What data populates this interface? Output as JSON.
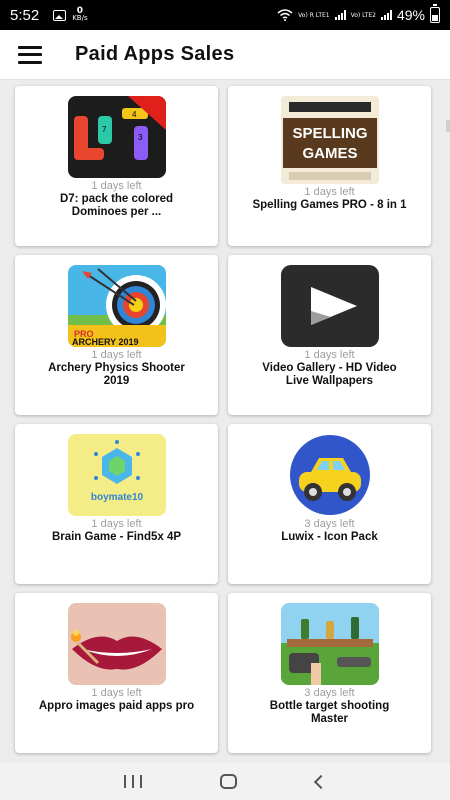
{
  "status": {
    "time": "5:52",
    "net_speed": "0",
    "net_unit": "KB/s",
    "lte1": "Vo) R LTE1",
    "lte2": "Vo) LTE2",
    "battery": "49%"
  },
  "app_bar": {
    "title": "Paid Apps Sales"
  },
  "apps": [
    {
      "days": "1 days left",
      "name": "D7: pack the colored Dominoes per ...",
      "icon": "domino-game-icon"
    },
    {
      "days": "1 days left",
      "name": "Spelling Games PRO - 8 in 1",
      "icon": "spelling-games-icon",
      "icon_text": "SPELLING GAMES"
    },
    {
      "days": "1 days left",
      "name": "Archery Physics Shooter 2019",
      "icon": "archery-target-icon",
      "icon_text": "PRO ARCHERY 2019"
    },
    {
      "days": "1 days left",
      "name": "Video Gallery - HD Video Live Wallpapers",
      "icon": "play-icon"
    },
    {
      "days": "1 days left",
      "name": "Brain Game - Find5x 4P",
      "icon": "hexagon-brain-icon",
      "icon_text": "boymate10"
    },
    {
      "days": "3 days left",
      "name": "Luwix - Icon Pack",
      "icon": "car-icon"
    },
    {
      "days": "1 days left",
      "name": "Appro images paid apps pro",
      "icon": "lips-match-icon"
    },
    {
      "days": "3 days left",
      "name": "Bottle target shooting Master",
      "icon": "bottle-shooting-icon"
    }
  ]
}
